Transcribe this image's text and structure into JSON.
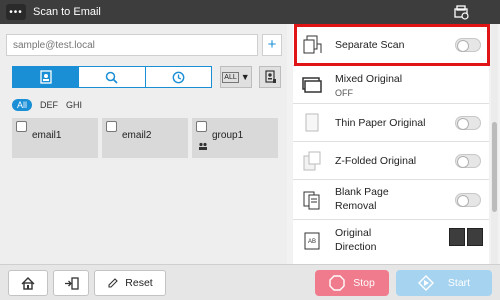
{
  "titlebar": {
    "menu_icon": "ellipsis-icon",
    "title": "Scan to Email",
    "corner_icon": "device-status-icon"
  },
  "address_input": {
    "placeholder": "sample@test.local",
    "value": ""
  },
  "add_button": {
    "icon": "plus-icon",
    "label": "+"
  },
  "search_tabs": [
    {
      "icon": "address-book-icon",
      "active": true
    },
    {
      "icon": "search-icon",
      "active": false
    },
    {
      "icon": "history-clock-icon",
      "active": false
    }
  ],
  "filter_dropdown": {
    "value": "ALL"
  },
  "filters": [
    "All",
    "DEF",
    "GHI"
  ],
  "destinations": [
    {
      "name": "email1",
      "type": "email"
    },
    {
      "name": "email2",
      "type": "email"
    },
    {
      "name": "group1",
      "type": "group"
    }
  ],
  "options": [
    {
      "label": "Separate Scan",
      "sub": "",
      "toggle": false
    },
    {
      "label": "Mixed Original",
      "sub": "OFF",
      "toggle": null
    },
    {
      "label": "Thin Paper Original",
      "sub": "",
      "toggle": false
    },
    {
      "label": "Z-Folded Original",
      "sub": "",
      "toggle": false
    },
    {
      "label_line1": "Blank Page",
      "label_line2": "Removal",
      "toggle": false
    },
    {
      "label_line1": "Original",
      "label_line2": "Direction"
    }
  ],
  "bottom": {
    "home_icon": "home-icon",
    "access_icon": "access-icon",
    "reset_label": "Reset",
    "stop_label": "Stop",
    "start_label": "Start"
  },
  "colors": {
    "accent": "#1a8fd6",
    "highlight": "#e01414",
    "stop": "#ef7b8c",
    "start": "#a6d3ef",
    "titlebar": "#3d3d3d"
  }
}
